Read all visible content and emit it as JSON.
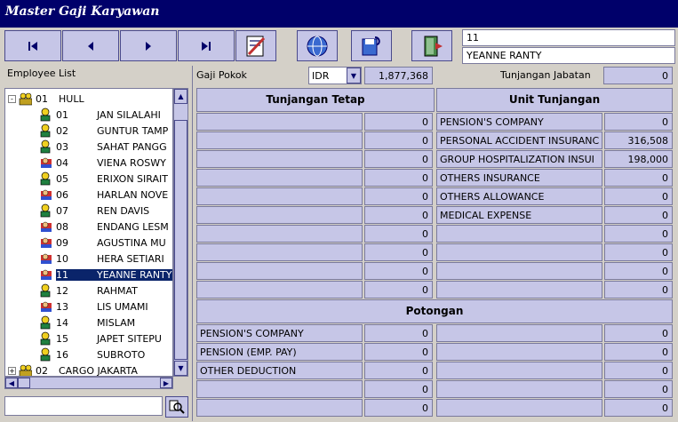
{
  "window": {
    "title": "Master Gaji Karyawan"
  },
  "nav": {
    "first": "⏮",
    "prev": "◀",
    "next": "▶",
    "last": "⏭"
  },
  "header_fields": {
    "emp_code": "11",
    "emp_name": "YEANNE RANTY"
  },
  "employee_list": {
    "label": "Employee List",
    "groups": [
      {
        "code": "01",
        "name": "HULL",
        "expanded": true
      },
      {
        "code": "02",
        "name": "CARGO JAKARTA",
        "expanded": false
      }
    ],
    "items": [
      {
        "code": "01",
        "name": "JAN SILALAHI",
        "icon": "person-yellow"
      },
      {
        "code": "02",
        "name": "GUNTUR TAMP",
        "icon": "person-yellow"
      },
      {
        "code": "03",
        "name": "SAHAT PANGG",
        "icon": "person-yellow"
      },
      {
        "code": "04",
        "name": "VIENA ROSWY",
        "icon": "person-flag"
      },
      {
        "code": "05",
        "name": "ERIXON SIRAIT",
        "icon": "person-yellow"
      },
      {
        "code": "06",
        "name": "HARLAN NOVE",
        "icon": "person-flag"
      },
      {
        "code": "07",
        "name": "REN DAVIS",
        "icon": "person-yellow"
      },
      {
        "code": "08",
        "name": "ENDANG LESM",
        "icon": "person-flag"
      },
      {
        "code": "09",
        "name": "AGUSTINA MU",
        "icon": "person-flag"
      },
      {
        "code": "10",
        "name": "HERA SETIARI",
        "icon": "person-flag"
      },
      {
        "code": "11",
        "name": "YEANNE RANTY",
        "icon": "person-flag"
      },
      {
        "code": "12",
        "name": "RAHMAT",
        "icon": "person-yellow"
      },
      {
        "code": "13",
        "name": "LIS UMAMI",
        "icon": "person-flag"
      },
      {
        "code": "14",
        "name": "MISLAM",
        "icon": "person-yellow"
      },
      {
        "code": "15",
        "name": "JAPET SITEPU",
        "icon": "person-yellow"
      },
      {
        "code": "16",
        "name": "SUBROTO",
        "icon": "person-yellow"
      }
    ],
    "selected_code": "11",
    "search_value": ""
  },
  "salary": {
    "gaji_pokok_label": "Gaji Pokok",
    "currency": "IDR",
    "gaji_pokok_value": "1,877,368",
    "tunjangan_jabatan_label": "Tunjangan Jabatan",
    "tunjangan_jabatan_value": "0"
  },
  "tunjangan_tetap": {
    "title": "Tunjangan Tetap",
    "rows": [
      {
        "name": "",
        "value": "0"
      },
      {
        "name": "",
        "value": "0"
      },
      {
        "name": "",
        "value": "0"
      },
      {
        "name": "",
        "value": "0"
      },
      {
        "name": "",
        "value": "0"
      },
      {
        "name": "",
        "value": "0"
      },
      {
        "name": "",
        "value": "0"
      },
      {
        "name": "",
        "value": "0"
      },
      {
        "name": "",
        "value": "0"
      },
      {
        "name": "",
        "value": "0"
      }
    ]
  },
  "unit_tunjangan": {
    "title": "Unit Tunjangan",
    "rows": [
      {
        "name": "PENSION'S COMPANY",
        "value": "0"
      },
      {
        "name": "PERSONAL ACCIDENT INSURANC",
        "value": "316,508"
      },
      {
        "name": "GROUP HOSPITALIZATION INSUI",
        "value": "198,000"
      },
      {
        "name": "OTHERS INSURANCE",
        "value": "0"
      },
      {
        "name": "OTHERS ALLOWANCE",
        "value": "0"
      },
      {
        "name": "MEDICAL EXPENSE",
        "value": "0"
      },
      {
        "name": "",
        "value": "0"
      },
      {
        "name": "",
        "value": "0"
      },
      {
        "name": "",
        "value": "0"
      },
      {
        "name": "",
        "value": "0"
      }
    ]
  },
  "potongan": {
    "title": "Potongan",
    "left": [
      {
        "name": "PENSION'S COMPANY",
        "value": "0"
      },
      {
        "name": "PENSION (EMP. PAY)",
        "value": "0"
      },
      {
        "name": "OTHER DEDUCTION",
        "value": "0"
      },
      {
        "name": "",
        "value": "0"
      },
      {
        "name": "",
        "value": "0"
      }
    ],
    "right": [
      {
        "name": "",
        "value": "0"
      },
      {
        "name": "",
        "value": "0"
      },
      {
        "name": "",
        "value": "0"
      },
      {
        "name": "",
        "value": "0"
      },
      {
        "name": "",
        "value": "0"
      }
    ]
  }
}
